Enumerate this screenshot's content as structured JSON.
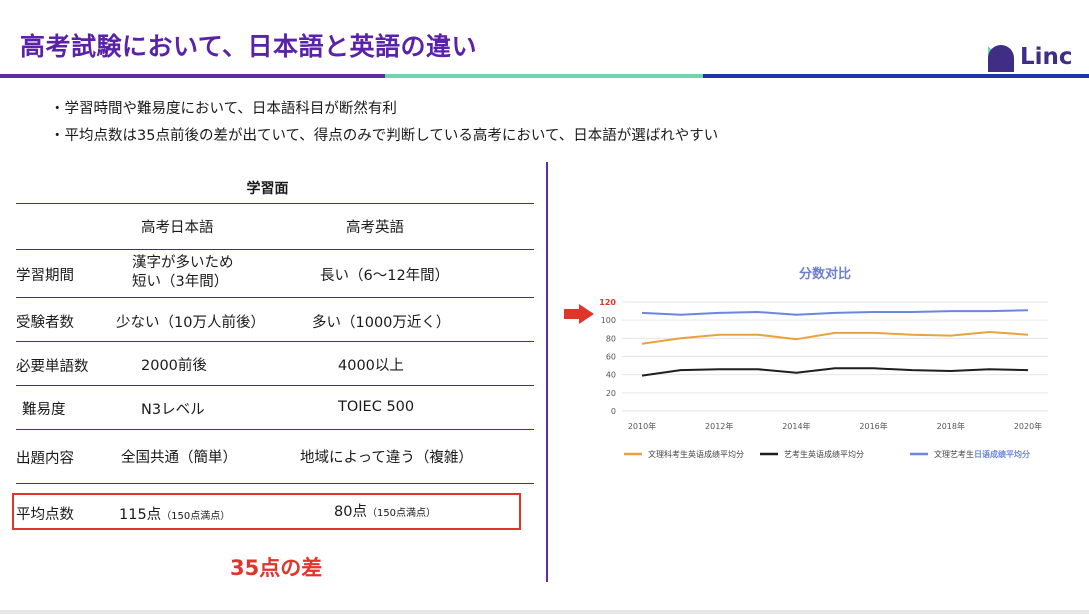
{
  "slide": {
    "title": "高考試験において、日本語と英語の違い",
    "logo_text": "Linc",
    "brand_colors": {
      "purple": "#5b2ba8",
      "mint": "#6fd4b0",
      "navy": "#2136a6",
      "red": "#e0352b"
    },
    "bullets": [
      "学習時間や難易度において、日本語科目が断然有利",
      "平均点数は35点前後の差が出ていて、得点のみで判断している高考において、日本語が選ばれやすい"
    ]
  },
  "table": {
    "title": "学習面",
    "headers": [
      "",
      "高考日本語",
      "高考英語"
    ],
    "rows": [
      {
        "label": "学習期間",
        "jp": [
          "漢字が多いため",
          "短い（3年間）"
        ],
        "en": "長い（6〜12年間）"
      },
      {
        "label": "受験者数",
        "jp": "少ない（10万人前後）",
        "en": "多い（1000万近く）"
      },
      {
        "label": "必要単語数",
        "jp": "2000前後",
        "en": "4000以上"
      },
      {
        "label": "難易度",
        "jp": "N3レベル",
        "en": "TOIEC 500"
      },
      {
        "label": "出題内容",
        "jp": "全国共通（簡単）",
        "en": "地域によって違う（複雑）"
      },
      {
        "label": "平均点数",
        "jp": "115点",
        "jp_note": "（150点満点）",
        "en": "80点",
        "en_note": "（150点満点）"
      }
    ],
    "diff_note": "35点の差"
  },
  "chart_data": {
    "type": "line",
    "title": "分数对比",
    "x": [
      "2010年",
      "2011年",
      "2012年",
      "2013年",
      "2014年",
      "2015年",
      "2016年",
      "2017年",
      "2018年",
      "2019年",
      "2020年"
    ],
    "x_tick_labels": [
      "2010年",
      "2012年",
      "2014年",
      "2016年",
      "2018年",
      "2020年"
    ],
    "ylim": [
      0,
      120
    ],
    "y_ticks": [
      0,
      20,
      40,
      60,
      80,
      100,
      120
    ],
    "highlight_tick": 120,
    "grid": true,
    "legend_position": "bottom",
    "series": [
      {
        "name": "文理科考生英语成绩平均分",
        "color": "#e8a33c",
        "values": [
          74,
          80,
          84,
          84,
          79,
          86,
          86,
          84,
          83,
          87,
          84
        ]
      },
      {
        "name": "艺考生英语成绩平均分",
        "color": "#1f1f1f",
        "values": [
          39,
          45,
          46,
          46,
          42,
          47,
          47,
          45,
          44,
          46,
          45
        ]
      },
      {
        "name": "文理艺考生日语成绩平均分",
        "color": "#6b86e0",
        "values": [
          108,
          106,
          108,
          109,
          106,
          108,
          109,
          109,
          110,
          110,
          111
        ]
      }
    ],
    "legend_label_parts": [
      {
        "plain": "文理科考生英语成绩平均分",
        "bold": ""
      },
      {
        "plain": "艺考生英语成绩平均分",
        "bold": ""
      },
      {
        "plain": "文理艺考生",
        "bold": "日语成绩平均分"
      }
    ]
  }
}
